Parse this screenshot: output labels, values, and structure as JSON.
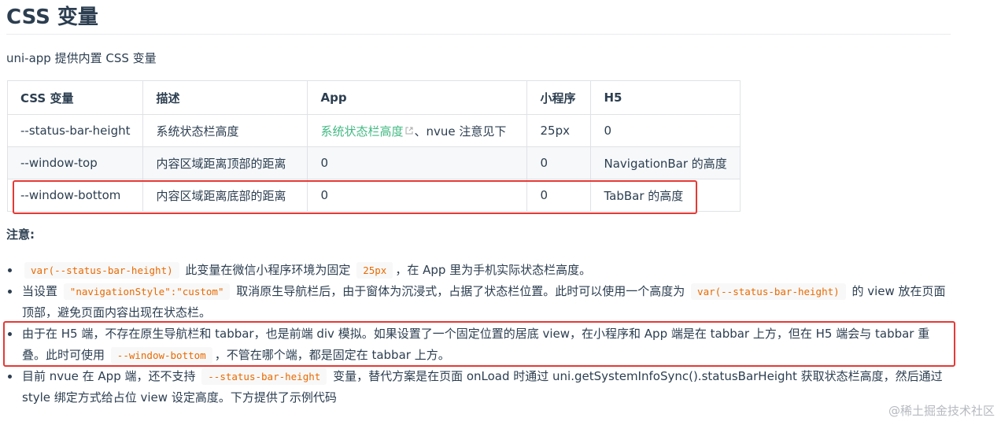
{
  "title": "CSS 变量",
  "intro": "uni-app 提供内置 CSS 变量",
  "table": {
    "headers": [
      "CSS 变量",
      "描述",
      "App",
      "小程序",
      "H5"
    ],
    "rows": [
      {
        "var": "--status-bar-height",
        "desc": "系统状态栏高度",
        "app_link": "系统状态栏高度",
        "app_rest": "、nvue 注意见下",
        "mp": "25px",
        "h5": "0"
      },
      {
        "var": "--window-top",
        "desc": "内容区域距离顶部的距离",
        "app": "0",
        "mp": "0",
        "h5": "NavigationBar 的高度"
      },
      {
        "var": "--window-bottom",
        "desc": "内容区域距离底部的距离",
        "app": "0",
        "mp": "0",
        "h5": "TabBar 的高度"
      }
    ]
  },
  "notes_heading": "注意:",
  "notes": [
    {
      "code1": "var(--status-bar-height)",
      "text1": "此变量在微信小程序环境为固定",
      "code2": "25px",
      "text2": "，在 App 里为手机实际状态栏高度。"
    },
    {
      "text1": "当设置",
      "code1": "\"navigationStyle\":\"custom\"",
      "text2": "取消原生导航栏后，由于窗体为沉浸式，占据了状态栏位置。此时可以使用一个高度为",
      "code2": "var(--status-bar-height)",
      "text3": "的 view 放在页面顶部，避免页面内容出现在状态栏。"
    },
    {
      "text1": "由于在 H5 端，不存在原生导航栏和 tabbar，也是前端 div 模拟。如果设置了一个固定位置的居底 view，在小程序和 App 端是在 tabbar 上方，但在 H5 端会与 tabbar 重叠。此时可使用",
      "code1": "--window-bottom",
      "text2": "，不管在哪个端，都是固定在 tabbar 上方。"
    },
    {
      "text1": "目前 nvue 在 App 端，还不支持",
      "code1": "--status-bar-height",
      "text2": "变量，替代方案是在页面 onLoad 时通过 uni.getSystemInfoSync().statusBarHeight 获取状态栏高度，然后通过 style 绑定方式给占位 view 设定高度。下方提供了示例代码"
    }
  ],
  "watermark": "@稀土掘金技术社区",
  "colors": {
    "text": "#2c3e50",
    "link": "#42b983",
    "code": "#e96900",
    "highlight": "#e53935"
  },
  "icons": {
    "external_link": "external-link-icon"
  }
}
